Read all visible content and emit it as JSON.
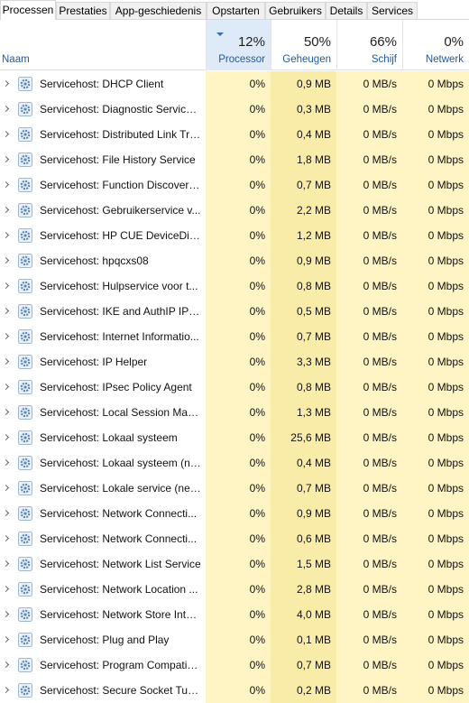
{
  "tabs": [
    {
      "label": "Processen",
      "active": true
    },
    {
      "label": "Prestaties",
      "active": false
    },
    {
      "label": "App-geschiedenis",
      "active": false
    },
    {
      "label": "Opstarten",
      "active": false
    },
    {
      "label": "Gebruikers",
      "active": false
    },
    {
      "label": "Details",
      "active": false
    },
    {
      "label": "Services",
      "active": false
    }
  ],
  "header": {
    "name_label": "Naam",
    "processor": {
      "pct": "12%",
      "label": "Processor",
      "sorted": true
    },
    "memory": {
      "pct": "50%",
      "label": "Geheugen"
    },
    "disk": {
      "pct": "66%",
      "label": "Schijf"
    },
    "network": {
      "pct": "0%",
      "label": "Netwerk"
    }
  },
  "rows": [
    {
      "name": "Servicehost: DHCP Client",
      "cpu": "0%",
      "mem": "0,9 MB",
      "disk": "0 MB/s",
      "net": "0 Mbps"
    },
    {
      "name": "Servicehost: Diagnostic Service ...",
      "cpu": "0%",
      "mem": "0,3 MB",
      "disk": "0 MB/s",
      "net": "0 Mbps"
    },
    {
      "name": "Servicehost: Distributed Link Tra...",
      "cpu": "0%",
      "mem": "0,4 MB",
      "disk": "0 MB/s",
      "net": "0 Mbps"
    },
    {
      "name": "Servicehost: File History Service",
      "cpu": "0%",
      "mem": "1,8 MB",
      "disk": "0 MB/s",
      "net": "0 Mbps"
    },
    {
      "name": "Servicehost: Function Discovery...",
      "cpu": "0%",
      "mem": "0,7 MB",
      "disk": "0 MB/s",
      "net": "0 Mbps"
    },
    {
      "name": "Servicehost: Gebruikerservice v...",
      "cpu": "0%",
      "mem": "2,2 MB",
      "disk": "0 MB/s",
      "net": "0 Mbps"
    },
    {
      "name": "Servicehost: HP CUE DeviceDisc...",
      "cpu": "0%",
      "mem": "1,2 MB",
      "disk": "0 MB/s",
      "net": "0 Mbps"
    },
    {
      "name": "Servicehost: hpqcxs08",
      "cpu": "0%",
      "mem": "0,9 MB",
      "disk": "0 MB/s",
      "net": "0 Mbps"
    },
    {
      "name": "Servicehost: Hulpservice voor t...",
      "cpu": "0%",
      "mem": "0,8 MB",
      "disk": "0 MB/s",
      "net": "0 Mbps"
    },
    {
      "name": "Servicehost: IKE and AuthIP IPse...",
      "cpu": "0%",
      "mem": "0,5 MB",
      "disk": "0 MB/s",
      "net": "0 Mbps"
    },
    {
      "name": "Servicehost: Internet Informatio...",
      "cpu": "0%",
      "mem": "0,7 MB",
      "disk": "0 MB/s",
      "net": "0 Mbps"
    },
    {
      "name": "Servicehost: IP Helper",
      "cpu": "0%",
      "mem": "3,3 MB",
      "disk": "0 MB/s",
      "net": "0 Mbps"
    },
    {
      "name": "Servicehost: IPsec Policy Agent",
      "cpu": "0%",
      "mem": "0,8 MB",
      "disk": "0 MB/s",
      "net": "0 Mbps"
    },
    {
      "name": "Servicehost: Local Session Man...",
      "cpu": "0%",
      "mem": "1,3 MB",
      "disk": "0 MB/s",
      "net": "0 Mbps"
    },
    {
      "name": "Servicehost: Lokaal systeem",
      "cpu": "0%",
      "mem": "25,6 MB",
      "disk": "0 MB/s",
      "net": "0 Mbps"
    },
    {
      "name": "Servicehost: Lokaal systeem (ne...",
      "cpu": "0%",
      "mem": "0,4 MB",
      "disk": "0 MB/s",
      "net": "0 Mbps"
    },
    {
      "name": "Servicehost: Lokale service (net...",
      "cpu": "0%",
      "mem": "0,7 MB",
      "disk": "0 MB/s",
      "net": "0 Mbps"
    },
    {
      "name": "Servicehost: Network Connecti...",
      "cpu": "0%",
      "mem": "0,9 MB",
      "disk": "0 MB/s",
      "net": "0 Mbps"
    },
    {
      "name": "Servicehost: Network Connecti...",
      "cpu": "0%",
      "mem": "0,6 MB",
      "disk": "0 MB/s",
      "net": "0 Mbps"
    },
    {
      "name": "Servicehost: Network List Service",
      "cpu": "0%",
      "mem": "1,5 MB",
      "disk": "0 MB/s",
      "net": "0 Mbps"
    },
    {
      "name": "Servicehost: Network Location ...",
      "cpu": "0%",
      "mem": "2,8 MB",
      "disk": "0 MB/s",
      "net": "0 Mbps"
    },
    {
      "name": "Servicehost: Network Store Inter...",
      "cpu": "0%",
      "mem": "4,0 MB",
      "disk": "0 MB/s",
      "net": "0 Mbps"
    },
    {
      "name": "Servicehost: Plug and Play",
      "cpu": "0%",
      "mem": "0,1 MB",
      "disk": "0 MB/s",
      "net": "0 Mbps"
    },
    {
      "name": "Servicehost: Program Compatib...",
      "cpu": "0%",
      "mem": "0,7 MB",
      "disk": "0 MB/s",
      "net": "0 Mbps"
    },
    {
      "name": "Servicehost: Secure Socket Tun...",
      "cpu": "0%",
      "mem": "0,2 MB",
      "disk": "0 MB/s",
      "net": "0 Mbps"
    }
  ]
}
